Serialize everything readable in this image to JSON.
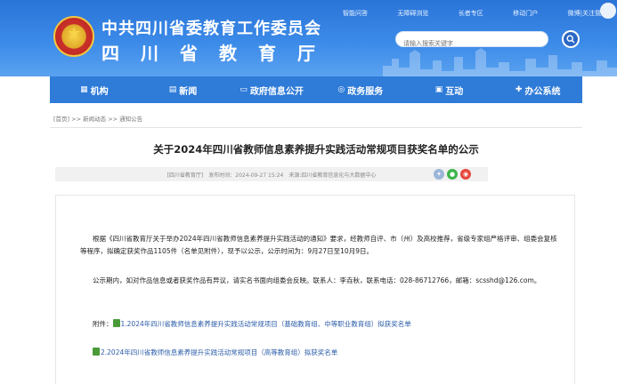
{
  "header": {
    "title_cn": "中共四川省委教育工作委员会",
    "title_sub": "四川省教育厅",
    "top_links": [
      "智能问答",
      "无障碍浏览",
      "长者专区",
      "移动门户",
      "微博|关注我"
    ],
    "search_placeholder": "请输入搜索关键字"
  },
  "nav": {
    "items": [
      {
        "label": "机构",
        "icon": "building-icon"
      },
      {
        "label": "新闻",
        "icon": "newspaper-icon"
      },
      {
        "label": "政府信息公开",
        "icon": "folder-icon"
      },
      {
        "label": "政务服务",
        "icon": "service-icon"
      },
      {
        "label": "互动",
        "icon": "chat-icon"
      },
      {
        "label": "办公系统",
        "icon": "office-icon"
      }
    ]
  },
  "breadcrumb": "[首页] >> 新闻动态 >> 通知公告",
  "article": {
    "title": "关于2024年四川省教师信息素养提升实践活动常规项目获奖名单的公示",
    "meta_source": "[四川省教育厅]",
    "meta_time": "发布时间：2024-09-27 15:24",
    "meta_from": "来源:四川省教育信息化与大数据中心",
    "para1": "根据《四川省教育厅关于举办2024年四川省教师信息素养提升实践活动的通知》要求，经教师自评、市（州）及高校推荐，省级专家组严格评审、组委会复核等程序，拟确定获奖作品1105件（名单见附件），现予以公示，公示时间为：9月27日至10月9日。",
    "para2": "公示期内，如对作品信息或者获奖作品有异议，请实名书面向组委会反映。联系人：李垚秋，联系电话：028-86712766，邮箱：scsshd@126.com。",
    "attach_label": "附件：",
    "attachments": [
      "1.2024年四川省教师信息素养提升实践活动常规项目（基础教育组、中等职业教育组）拟获奖名单",
      "2.2024年四川省教师信息素养提升实践活动常规项目（高等教育组）拟获奖名单"
    ]
  },
  "colors": {
    "header_blue": "#2a74d8",
    "nav_blue": "#2e7bd8",
    "link_blue": "#2b5ca8"
  }
}
